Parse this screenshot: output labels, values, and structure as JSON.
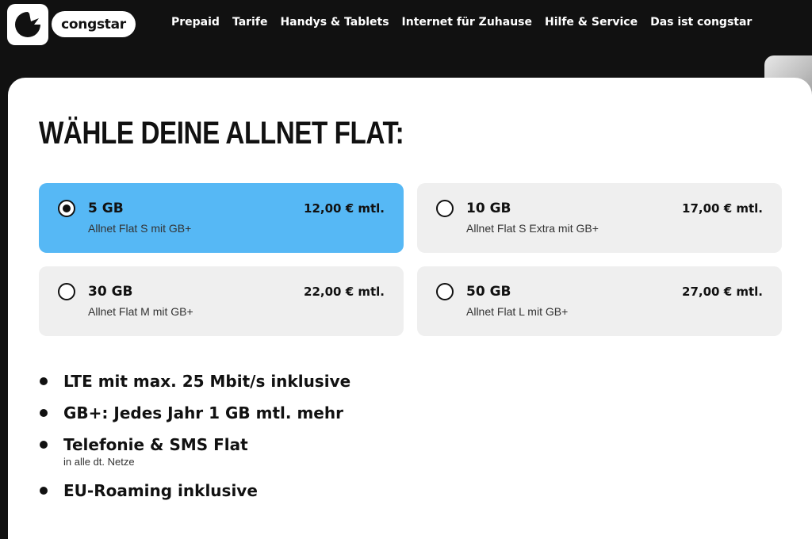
{
  "header": {
    "brand": "congstar",
    "nav": [
      {
        "label": "Prepaid"
      },
      {
        "label": "Tarife"
      },
      {
        "label": "Handys & Tablets"
      },
      {
        "label": "Internet für Zuhause"
      },
      {
        "label": "Hilfe & Service"
      },
      {
        "label": "Das ist congstar"
      }
    ]
  },
  "main": {
    "title": "WÄHLE DEINE ALLNET FLAT:",
    "options": [
      {
        "volume": "5 GB",
        "name": "Allnet Flat S mit GB+",
        "price": "12,00 € mtl.",
        "selected": true
      },
      {
        "volume": "10 GB",
        "name": "Allnet Flat S Extra mit GB+",
        "price": "17,00 € mtl.",
        "selected": false
      },
      {
        "volume": "30 GB",
        "name": "Allnet Flat M mit GB+",
        "price": "22,00 € mtl.",
        "selected": false
      },
      {
        "volume": "50 GB",
        "name": "Allnet Flat L mit GB+",
        "price": "27,00 € mtl.",
        "selected": false
      }
    ],
    "features": [
      {
        "text": "LTE mit max. 25 Mbit/s inklusive",
        "sub": ""
      },
      {
        "text": "GB+: Jedes Jahr 1 GB mtl. mehr",
        "sub": ""
      },
      {
        "text": "Telefonie & SMS Flat",
        "sub": "in alle dt. Netze"
      },
      {
        "text": "EU-Roaming inklusive",
        "sub": ""
      }
    ]
  },
  "colors": {
    "selected": "#56b8f5",
    "option_bg": "#efefef",
    "header_bg": "#111111"
  }
}
